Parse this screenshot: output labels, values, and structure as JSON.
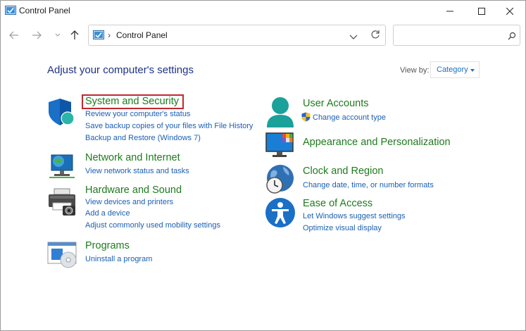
{
  "window": {
    "title": "Control Panel"
  },
  "address": {
    "crumb": "Control Panel"
  },
  "search": {
    "placeholder": ""
  },
  "main": {
    "heading": "Adjust your computer's settings",
    "view_by_label": "View by:",
    "view_by_value": "Category"
  },
  "categories": {
    "system": {
      "title": "System and Security",
      "links": [
        "Review your computer's status",
        "Save backup copies of your files with File History",
        "Backup and Restore (Windows 7)"
      ]
    },
    "network": {
      "title": "Network and Internet",
      "links": [
        "View network status and tasks"
      ]
    },
    "hardware": {
      "title": "Hardware and Sound",
      "links": [
        "View devices and printers",
        "Add a device",
        "Adjust commonly used mobility settings"
      ]
    },
    "programs": {
      "title": "Programs",
      "links": [
        "Uninstall a program"
      ]
    },
    "user": {
      "title": "User Accounts",
      "links": [
        "Change account type"
      ]
    },
    "appearance": {
      "title": "Appearance and Personalization",
      "links": []
    },
    "clock": {
      "title": "Clock and Region",
      "links": [
        "Change date, time, or number formats"
      ]
    },
    "ease": {
      "title": "Ease of Access",
      "links": [
        "Let Windows suggest settings",
        "Optimize visual display"
      ]
    }
  },
  "colors": {
    "heading": "#1e3287",
    "category_title": "#1d7b1d",
    "link": "#1a5fb4",
    "highlight": "#c1272d"
  },
  "icons": {
    "system": "shield-icon",
    "network": "network-icon",
    "hardware": "printer-icon",
    "programs": "programs-icon",
    "user": "user-icon",
    "appearance": "monitor-icon",
    "clock": "clock-globe-icon",
    "ease": "accessibility-icon"
  }
}
